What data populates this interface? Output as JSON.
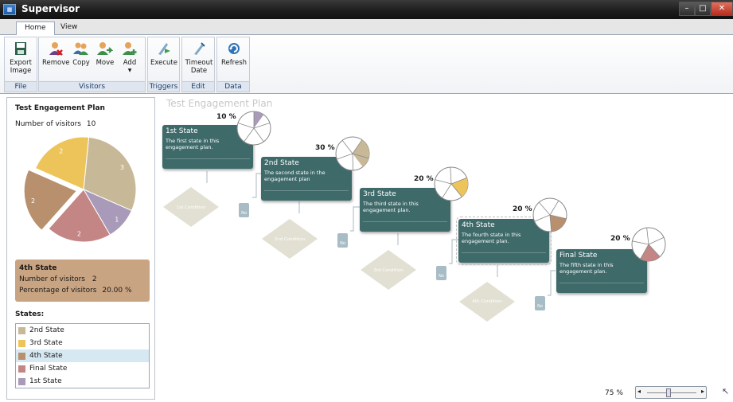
{
  "window": {
    "title": "Supervisor",
    "icon": "app-icon"
  },
  "tabs": [
    {
      "label": "Home"
    },
    {
      "label": "View"
    }
  ],
  "ribbon": {
    "groups": [
      {
        "label": "File",
        "buttons": [
          {
            "label": "Export\nImage",
            "icon": "export-image-icon"
          }
        ]
      },
      {
        "label": "Visitors",
        "buttons": [
          {
            "label": "Remove",
            "icon": "remove-visitor-icon"
          },
          {
            "label": "Copy",
            "icon": "copy-visitor-icon"
          },
          {
            "label": "Move",
            "icon": "move-visitor-icon"
          },
          {
            "label": "Add",
            "icon": "add-visitor-icon"
          }
        ]
      },
      {
        "label": "Triggers",
        "buttons": [
          {
            "label": "Execute",
            "icon": "execute-icon"
          }
        ]
      },
      {
        "label": "Edit",
        "buttons": [
          {
            "label": "Timeout\nDate",
            "icon": "timeout-date-icon"
          }
        ]
      },
      {
        "label": "Data",
        "buttons": [
          {
            "label": "Refresh",
            "icon": "refresh-icon"
          }
        ]
      }
    ]
  },
  "left_panel": {
    "plan_title": "Test Engagement Plan",
    "visitors_label": "Number of visitors",
    "visitors_value": "10",
    "pie_slices": [
      {
        "value": 3,
        "label": "3",
        "color": "#c7b998"
      },
      {
        "value": 1,
        "label": "1",
        "color": "#a89ab8"
      },
      {
        "value": 2,
        "label": "2",
        "color": "#c48585"
      },
      {
        "value": 2,
        "label": "2",
        "color": "#b8906d",
        "exploded": true
      },
      {
        "value": 2,
        "label": "2",
        "color": "#edc459"
      }
    ],
    "detail": {
      "title": "4th State",
      "visitors_label": "Number of visitors",
      "visitors_value": "2",
      "percentage_label": "Percentage of visitors",
      "percentage_value": "20.00 %"
    },
    "states_title": "States:",
    "states": [
      {
        "label": "2nd State",
        "color": "#c7b998"
      },
      {
        "label": "3rd State",
        "color": "#edc459"
      },
      {
        "label": "4th State",
        "color": "#b8906d",
        "selected": true
      },
      {
        "label": "Final State",
        "color": "#c48585"
      },
      {
        "label": "1st State",
        "color": "#a89ab8"
      }
    ]
  },
  "canvas": {
    "plan_title": "Test Engagement Plan",
    "states": [
      {
        "name": "1st State",
        "desc": "The first state in this engagement plan.",
        "percent": "10 %",
        "fill_color": "#a89ab8",
        "share": 0.1
      },
      {
        "name": "2nd State",
        "desc": "The second state in the engagement plan",
        "percent": "30 %",
        "fill_color": "#c7b998",
        "share": 0.3
      },
      {
        "name": "3rd State",
        "desc": "The third state in this engagement plan.",
        "percent": "20 %",
        "fill_color": "#edc459",
        "share": 0.2
      },
      {
        "name": "4th State",
        "desc": "The fourth state in this engagement plan.",
        "percent": "20 %",
        "fill_color": "#b8906d",
        "share": 0.2
      },
      {
        "name": "Final State",
        "desc": "The fifth state in this engagement plan.",
        "percent": "20 %",
        "fill_color": "#c48585",
        "share": 0.2
      }
    ],
    "conditions": [
      {
        "label": "1st Condition",
        "no_label": "No"
      },
      {
        "label": "2nd Condition",
        "no_label": "No"
      },
      {
        "label": "3rd Condition",
        "no_label": "No"
      },
      {
        "label": "4th Condition",
        "no_label": "No"
      }
    ]
  },
  "zoom": {
    "value": "75 %"
  }
}
